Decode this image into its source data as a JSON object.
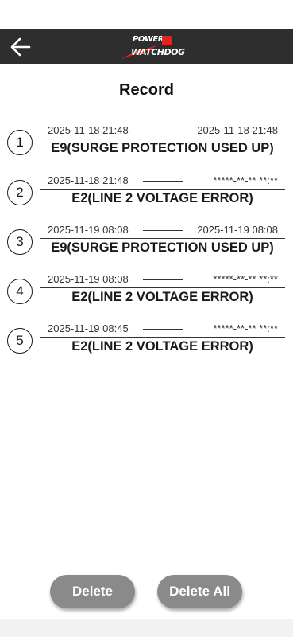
{
  "header": {
    "back_icon": "arrow-left-icon",
    "logo_line1": "POWER",
    "logo_line2": "WATCHDOG",
    "colors": {
      "bar": "#2e2e2e",
      "logo_accent": "#e32222"
    }
  },
  "page_title": "Record",
  "records": [
    {
      "index": "1",
      "start": "2025-11-18 21:48",
      "end": "2025-11-18 21:48",
      "error": "E9(SURGE PROTECTION USED UP)"
    },
    {
      "index": "2",
      "start": "2025-11-18 21:48",
      "end": "*****-**-** **:**",
      "error": "E2(LINE 2 VOLTAGE ERROR)"
    },
    {
      "index": "3",
      "start": "2025-11-19 08:08",
      "end": "2025-11-19 08:08",
      "error": "E9(SURGE PROTECTION USED UP)"
    },
    {
      "index": "4",
      "start": "2025-11-19 08:08",
      "end": "*****-**-** **:**",
      "error": "E2(LINE 2 VOLTAGE ERROR)"
    },
    {
      "index": "5",
      "start": "2025-11-19 08:45",
      "end": "*****-**-** **:**",
      "error": "E2(LINE 2 VOLTAGE ERROR)"
    }
  ],
  "actions": {
    "delete_label": "Delete",
    "delete_all_label": "Delete All",
    "button_color": "#8a8a8a"
  }
}
